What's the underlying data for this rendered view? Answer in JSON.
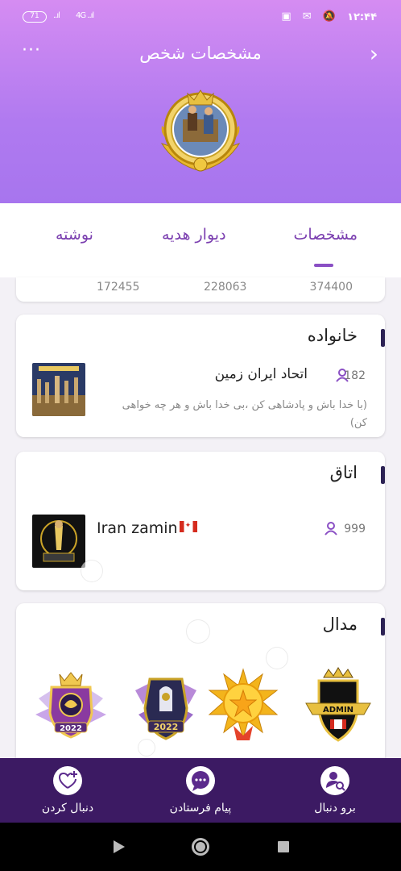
{
  "status_bar": {
    "battery": "71",
    "signal_1": "..ıl",
    "signal_2": "4G ..ıl",
    "icons": "▣ ✉ 🔕",
    "time": "۱۲:۴۴"
  },
  "header": {
    "title": "مشخصات شخص",
    "more_label": "···",
    "back_label": "›"
  },
  "tabs": [
    {
      "label": "مشخصات"
    },
    {
      "label": "دیوار هدیه"
    },
    {
      "label": "نوشته"
    }
  ],
  "stats": [
    "374400",
    "228063",
    "172455"
  ],
  "family": {
    "title": "خانواده",
    "name": "اتحاد ایران زمین",
    "member_count": "182",
    "description": "(با خدا باش و پادشاهی کن ،بی خدا باش و هر چه خواهی کن)"
  },
  "room": {
    "title": "اتاق",
    "name": "Iran zamin",
    "member_count": "999"
  },
  "medals": {
    "title": "مدال",
    "items": [
      "admin-medal",
      "sun-star-medal",
      "2022-shield-medal",
      "2022-crest-medal"
    ]
  },
  "actions": {
    "go_follow": "برو دنبال",
    "send_message": "پیام فرستادن",
    "follow": "دنبال کردن"
  },
  "colors": {
    "header_top": "#d58cf2",
    "header_bottom": "#a775ee",
    "accent": "#7b3fb0",
    "bottom_bar": "#3c1a63"
  }
}
